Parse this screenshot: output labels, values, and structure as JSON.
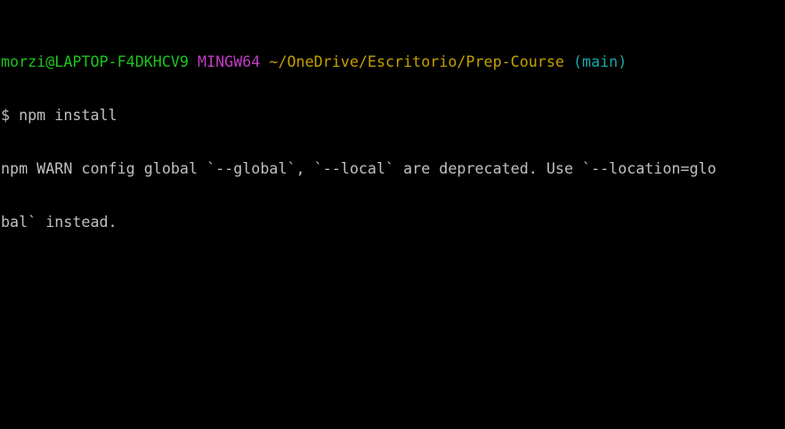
{
  "prompt": {
    "user_host": "morzi@LAPTOP-F4DKHCV9",
    "system": "MINGW64",
    "path": "~/OneDrive/Escritorio/Prep-Course",
    "branch": "(main)"
  },
  "command_line": {
    "symbol": "$",
    "command": "npm install"
  },
  "output": [
    "npm WARN config global `--global`, `--local` are deprecated. Use `--location=glo",
    "bal` instead."
  ],
  "colors": {
    "background": "#000000",
    "text": "#c0c0c0",
    "user_host": "#1cc41c",
    "system": "#c33bc3",
    "path": "#c4a000",
    "branch": "#17a8a8"
  }
}
